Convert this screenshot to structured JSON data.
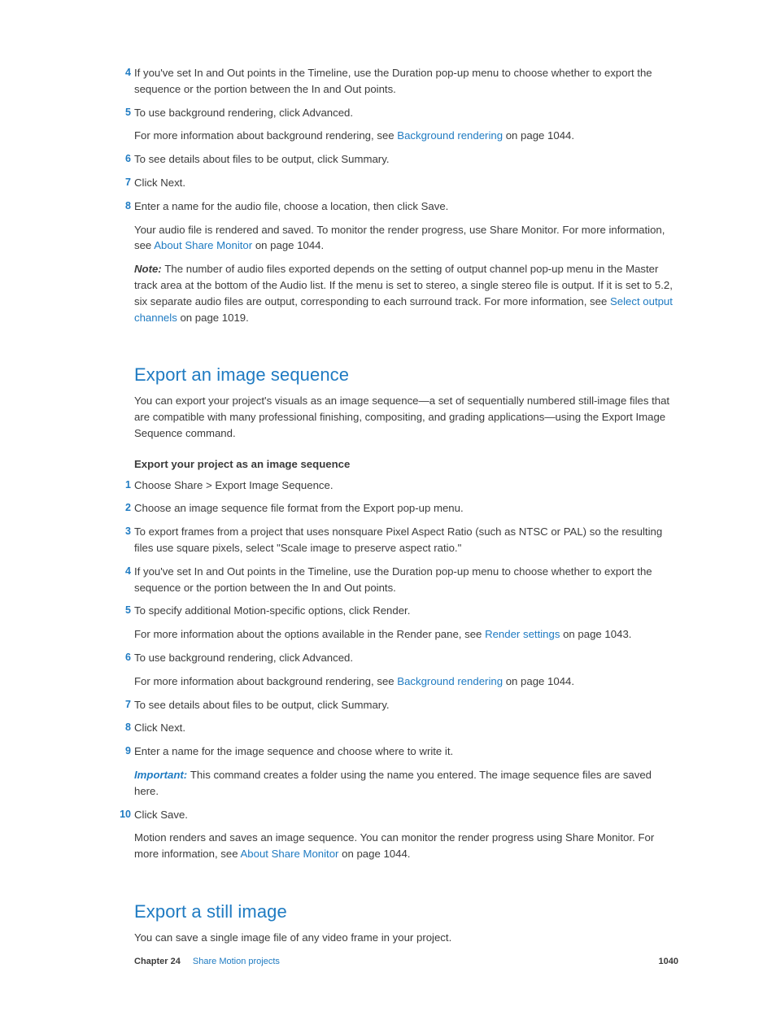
{
  "top_steps": [
    {
      "n": "4",
      "text": "If you've set In and Out points in the Timeline, use the Duration pop-up menu to choose whether to export the sequence or the portion between the In and Out points."
    },
    {
      "n": "5",
      "text": "To use background rendering, click Advanced.",
      "follow_before": "For more information about background rendering, see ",
      "follow_link": "Background rendering",
      "follow_after": " on page 1044."
    },
    {
      "n": "6",
      "text": "To see details about files to be output, click Summary."
    },
    {
      "n": "7",
      "text": "Click Next."
    },
    {
      "n": "8",
      "text": "Enter a name for the audio file, choose a location, then click Save.",
      "p1_before": "Your audio file is rendered and saved. To monitor the render progress, use Share Monitor. For more information, see ",
      "p1_link": "About Share Monitor",
      "p1_after": " on page 1044.",
      "note_label": "Note:  ",
      "note_before": "The number of audio files exported depends on the setting of output channel pop-up menu in the Master track area at the bottom of the Audio list. If the menu is set to stereo, a single stereo file is output. If it is set to 5.2, six separate audio files are output, corresponding to each surround track. For more information, see ",
      "note_link": "Select output channels",
      "note_after": " on page 1019."
    }
  ],
  "section1": {
    "title": "Export an image sequence",
    "intro": "You can export your project's visuals as an image sequence—a set of sequentially numbered still-image files that are compatible with many professional finishing, compositing, and grading applications—using the Export Image Sequence command.",
    "sub": "Export your project as an image sequence",
    "steps": [
      {
        "n": "1",
        "text": "Choose Share > Export Image Sequence."
      },
      {
        "n": "2",
        "text": "Choose an image sequence file format from the Export pop-up menu."
      },
      {
        "n": "3",
        "text": "To export frames from a project that uses nonsquare Pixel Aspect Ratio (such as NTSC or PAL) so the resulting files use square pixels, select \"Scale image to preserve aspect ratio.\""
      },
      {
        "n": "4",
        "text": "If you've set In and Out points in the Timeline, use the Duration pop-up menu to choose whether to export the sequence or the portion between the In and Out points."
      },
      {
        "n": "5",
        "text": "To specify additional Motion-specific options, click Render.",
        "follow_before": "For more information about the options available in the Render pane, see ",
        "follow_link": "Render settings",
        "follow_after": " on page 1043."
      },
      {
        "n": "6",
        "text": "To use background rendering, click Advanced.",
        "follow_before": " For more information about background rendering, see ",
        "follow_link": "Background rendering",
        "follow_after": " on page 1044."
      },
      {
        "n": "7",
        "text": "To see details about files to be output, click Summary."
      },
      {
        "n": "8",
        "text": "Click Next."
      },
      {
        "n": "9",
        "text": "Enter a name for the image sequence and choose where to write it.",
        "imp_label": "Important:  ",
        "imp_text": "This command creates a folder using the name you entered. The image sequence files are saved here."
      },
      {
        "n": "10",
        "text": "Click Save.",
        "p1_before": "Motion renders and saves an image sequence. You can monitor the render progress using Share Monitor. For more information, see ",
        "p1_link": "About Share Monitor",
        "p1_after": " on page 1044."
      }
    ]
  },
  "section2": {
    "title": "Export a still image",
    "intro": "You can save a single image file of any video frame in your project."
  },
  "footer": {
    "chapter_label": "Chapter 24",
    "chapter_name": "Share Motion projects",
    "page": "1040"
  }
}
